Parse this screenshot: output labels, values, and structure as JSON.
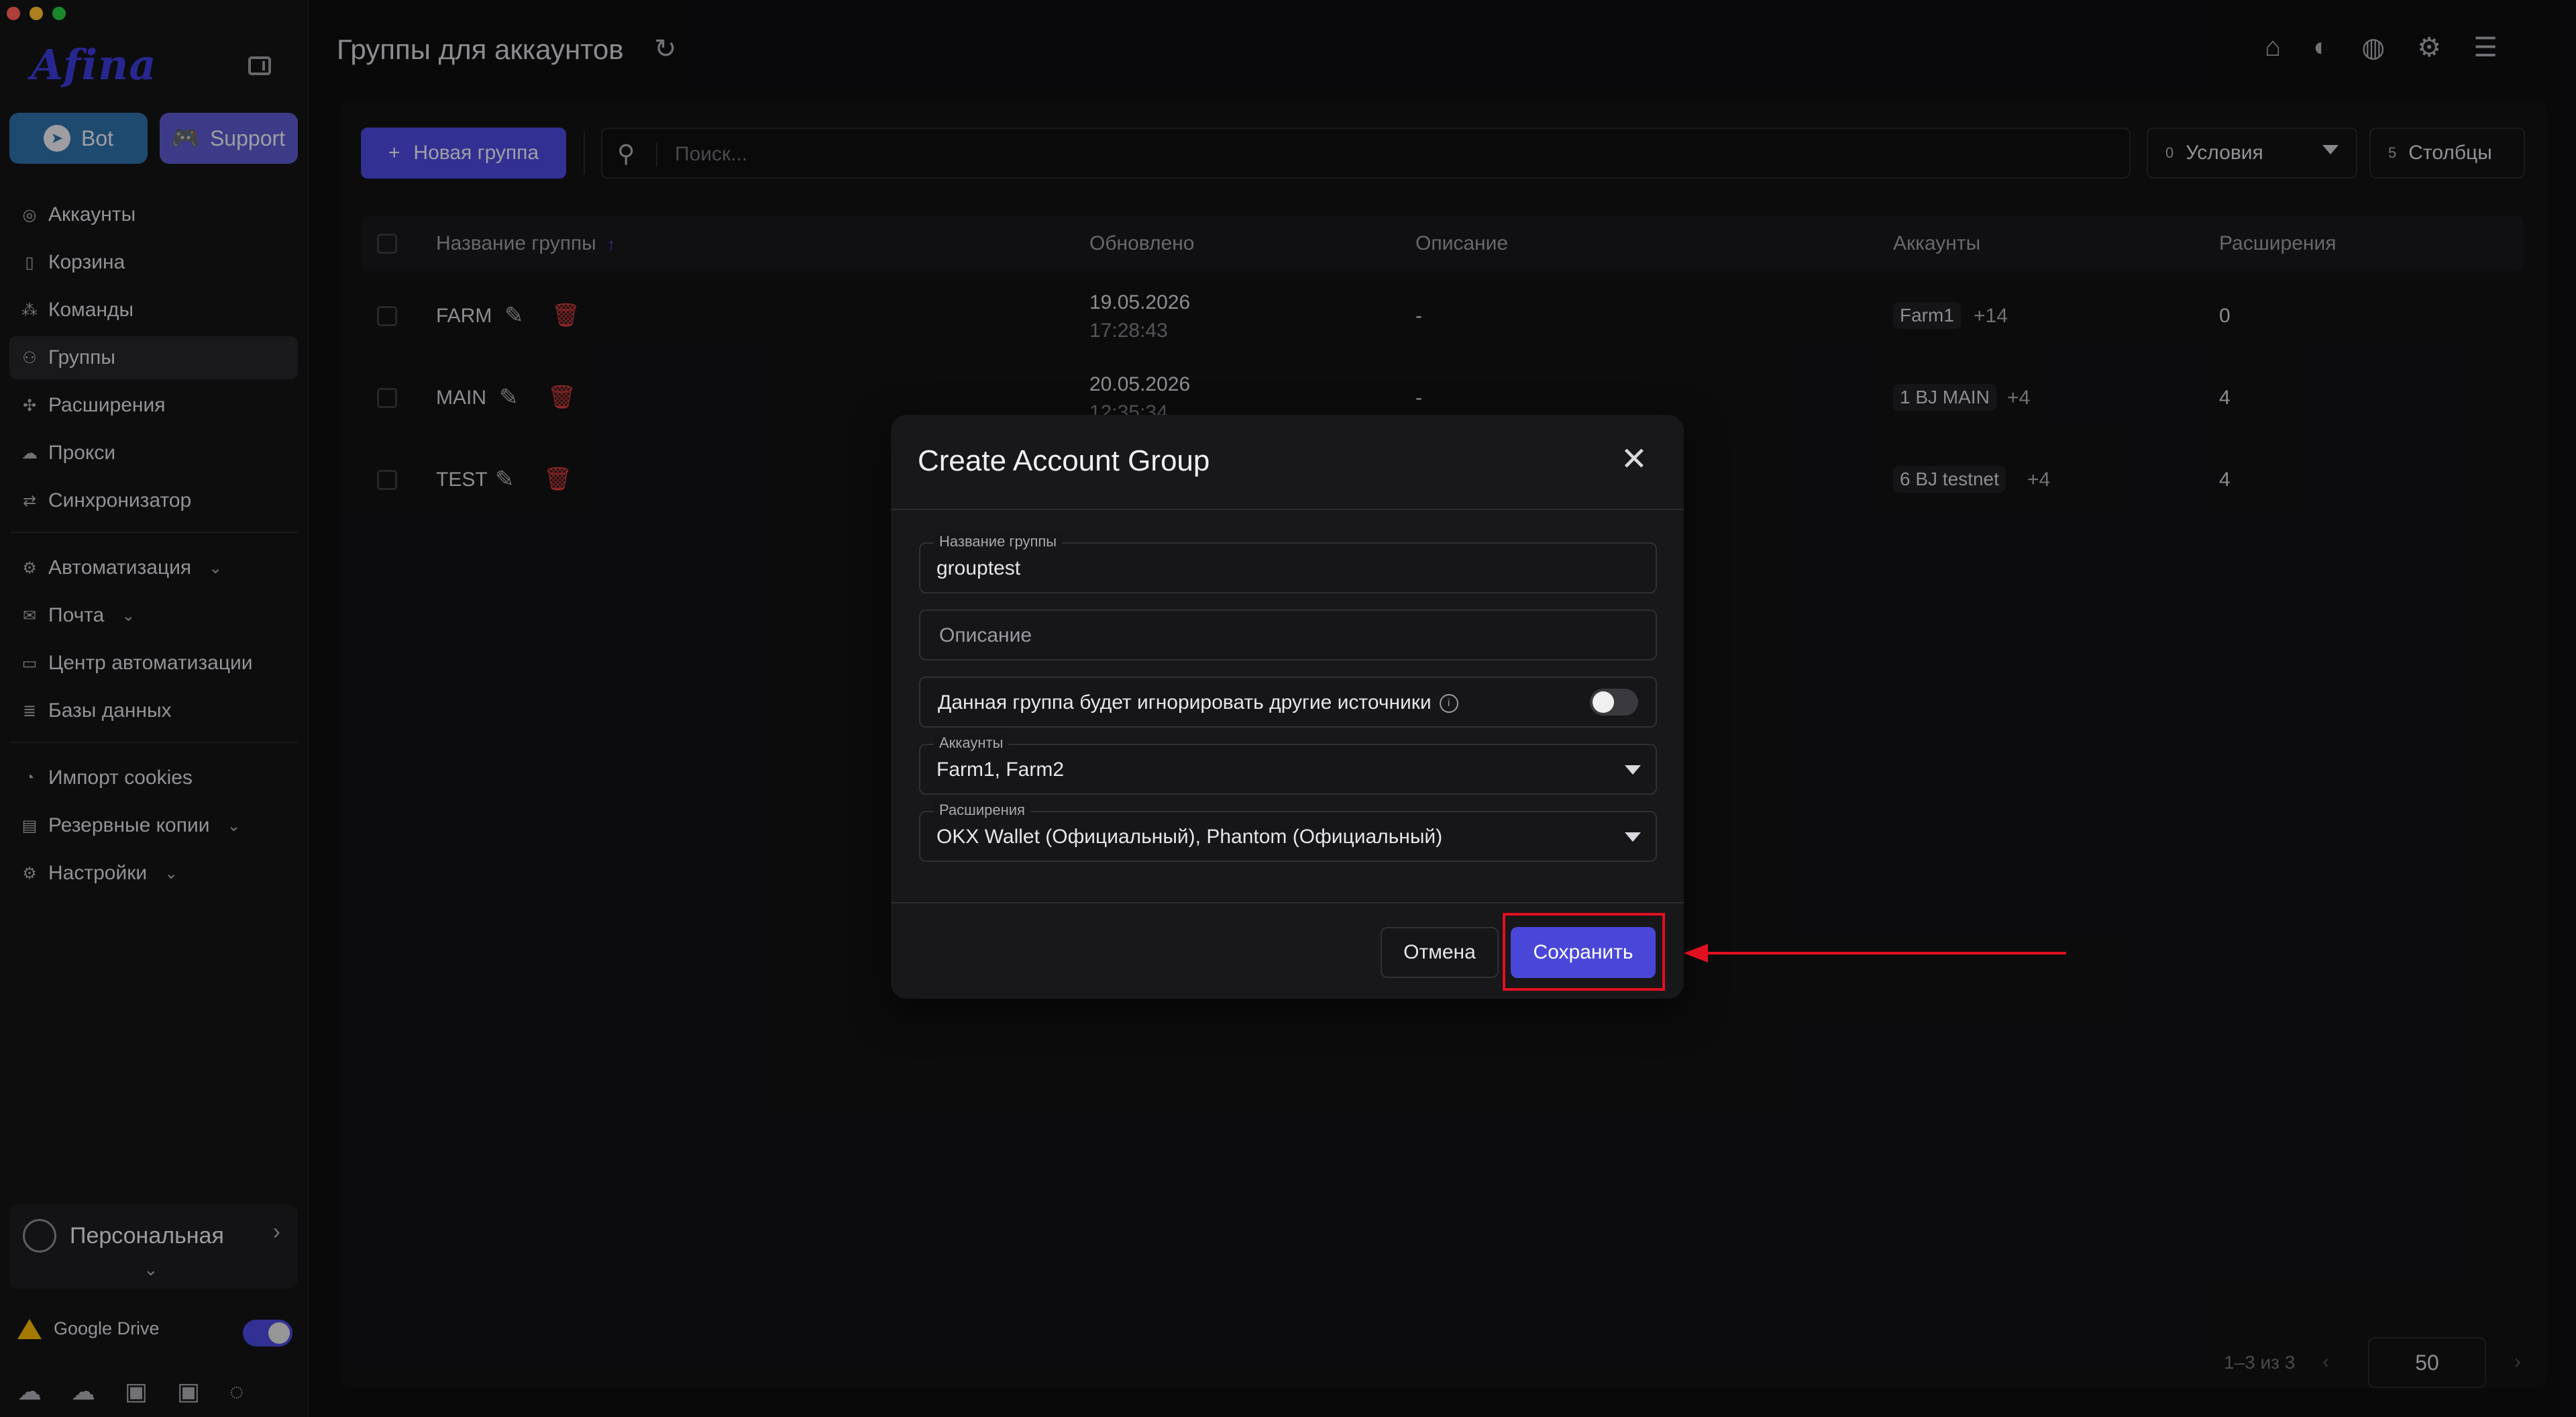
{
  "sidebar": {
    "logo": "Afina",
    "bot_label": "Bot",
    "support_label": "Support",
    "items": [
      {
        "label": "Аккаунты",
        "icon": "user-circle-icon"
      },
      {
        "label": "Корзина",
        "icon": "trash-icon"
      },
      {
        "label": "Команды",
        "icon": "team-icon"
      },
      {
        "label": "Группы",
        "icon": "group-icon",
        "active": true
      },
      {
        "label": "Расширения",
        "icon": "puzzle-icon"
      },
      {
        "label": "Прокси",
        "icon": "cloud-icon"
      },
      {
        "label": "Синхронизатор",
        "icon": "sync-icon"
      }
    ],
    "items2": [
      {
        "label": "Автоматизация",
        "icon": "automation-icon",
        "expandable": true
      },
      {
        "label": "Почта",
        "icon": "mail-icon",
        "expandable": true
      },
      {
        "label": "Центр автоматизации",
        "icon": "laptop-icon"
      },
      {
        "label": "Базы данных",
        "icon": "database-icon"
      }
    ],
    "items3": [
      {
        "label": "Импорт cookies",
        "icon": "cookie-icon"
      },
      {
        "label": "Резервные копии",
        "icon": "backup-icon",
        "expandable": true
      },
      {
        "label": "Настройки",
        "icon": "gear-icon",
        "expandable": true
      }
    ],
    "profile_name": "Персональная",
    "gdrive_label": "Google Drive",
    "gdrive_enabled": true
  },
  "header": {
    "title": "Группы для аккаунтов"
  },
  "toolbar": {
    "new_group_label": "Новая группа",
    "search_placeholder": "Поиск...",
    "conditions_count": "0",
    "conditions_label": "Условия",
    "columns_count": "5",
    "columns_label": "Столбцы"
  },
  "table": {
    "columns": [
      "Название группы",
      "Обновлено",
      "Описание",
      "Аккаунты",
      "Расширения"
    ],
    "sort_indicator": "↑",
    "rows": [
      {
        "name": "FARM",
        "date": "19.05.2026",
        "time": "17:28:43",
        "description": "-",
        "account": "Farm1",
        "more": "+14",
        "extensions": "0"
      },
      {
        "name": "MAIN",
        "date": "20.05.2026",
        "time": "12:35:34",
        "description": "-",
        "account": "1 BJ MAIN",
        "more": "+4",
        "extensions": "4"
      },
      {
        "name": "TEST",
        "date": "",
        "time": "",
        "description": "",
        "account": "6 BJ testnet",
        "more": "+4",
        "extensions": "4"
      }
    ]
  },
  "pager": {
    "range": "1–3 из 3",
    "page_size": "50"
  },
  "modal": {
    "title": "Create Account Group",
    "name_label": "Название группы",
    "name_value": "grouptest",
    "description_placeholder": "Описание",
    "ignore_label": "Данная группа будет игнорировать другие источники",
    "ignore_enabled": false,
    "accounts_label": "Аккаунты",
    "accounts_value": "Farm1, Farm2",
    "extensions_label": "Расширения",
    "extensions_value": "OKX Wallet (Официальный), Phantom (Официальный)",
    "cancel_label": "Отмена",
    "save_label": "Сохранить"
  },
  "colors": {
    "accent": "#4a47d8",
    "annotation": "#e01020",
    "bot": "#2f6ea6",
    "support": "#5b57c9"
  }
}
